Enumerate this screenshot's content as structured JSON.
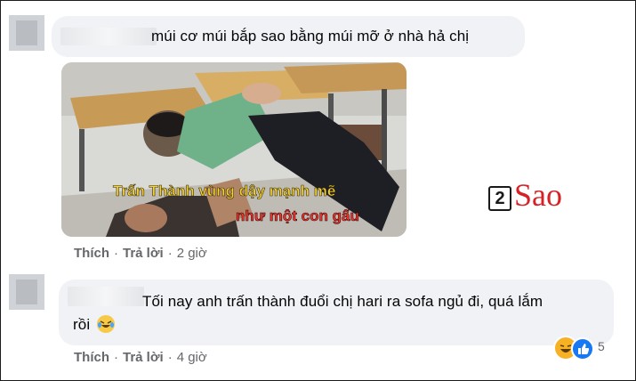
{
  "comments": [
    {
      "text": "múi cơ múi bắp sao bằng múi mỡ ở nhà hả chị",
      "actions": {
        "like": "Thích",
        "reply": "Trả lời",
        "time": "2 giờ"
      },
      "image_caption_line1": "Trấn Thành vùng dậy mạnh mẽ",
      "image_caption_line2": "như một con gấu"
    },
    {
      "text_line1": "Tối nay anh trấn thành đuổi chị hari ra sofa ngủ đi, quá lắm",
      "text_line2": "rồi",
      "emoji": "laughing-crying-emoji",
      "actions": {
        "like": "Thích",
        "reply": "Trả lời",
        "time": "4 giờ"
      },
      "reactions": {
        "icons": [
          "haha-icon",
          "like-icon"
        ],
        "count": "5"
      }
    }
  ],
  "watermark": {
    "number": "2",
    "word": "Sao",
    "color": "#d62127"
  },
  "colors": {
    "bubble": "#f0f2f5",
    "meta": "#65676b",
    "like": "#1877f2",
    "haha": "#f7b125"
  }
}
